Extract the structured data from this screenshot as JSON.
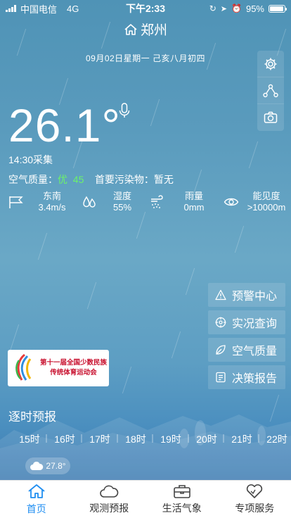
{
  "status_bar": {
    "carrier": "中国电信",
    "network": "4G",
    "time": "下午2:33",
    "battery": "95%",
    "battery_level": 0.95
  },
  "header": {
    "city": "郑州",
    "date": "09月02日星期一   己亥八月初四"
  },
  "tools": [
    {
      "icon": "gear-icon"
    },
    {
      "icon": "share-icon"
    },
    {
      "icon": "camera-icon"
    }
  ],
  "weather": {
    "temperature": "26.1°",
    "collect_time": "14:30采集",
    "air_quality_label": "空气质量：",
    "air_quality_level": "优",
    "air_quality_value": "45",
    "primary_pollutant": "首要污染物：暂无"
  },
  "metrics": [
    {
      "icon": "wind-flag-icon",
      "line1": "东南",
      "line2": "3.4m/s"
    },
    {
      "icon": "humidity-drops-icon",
      "line1": "湿度",
      "line2": "55%"
    },
    {
      "icon": "rain-icon",
      "line1": "雨量",
      "line2": "0mm"
    },
    {
      "icon": "eye-icon",
      "line1": "能见度",
      "line2": ">10000m"
    }
  ],
  "actions": [
    {
      "icon": "warning-icon",
      "label": "预警中心"
    },
    {
      "icon": "target-icon",
      "label": "实况查询"
    },
    {
      "icon": "leaf-icon",
      "label": "空气质量"
    },
    {
      "icon": "report-icon",
      "label": "决策报告"
    }
  ],
  "banner": {
    "line1": "第十一届全国少数民族",
    "line2": "传统体育运动会"
  },
  "hourly": {
    "title": "逐时预报",
    "hours": [
      "15时",
      "16时",
      "17时",
      "18时",
      "19时",
      "20时",
      "21时",
      "22时"
    ],
    "first_temp": "27.8°"
  },
  "tabbar": [
    {
      "icon": "home-icon",
      "label": "首页",
      "active": true
    },
    {
      "icon": "cloud-icon",
      "label": "观测预报",
      "active": false
    },
    {
      "icon": "briefcase-icon",
      "label": "生活气象",
      "active": false
    },
    {
      "icon": "heart-icon",
      "label": "专项服务",
      "active": false
    }
  ],
  "colors": {
    "accent": "#1f8ef1",
    "good_air": "#6cf26a",
    "banner_text": "#c8102e"
  }
}
